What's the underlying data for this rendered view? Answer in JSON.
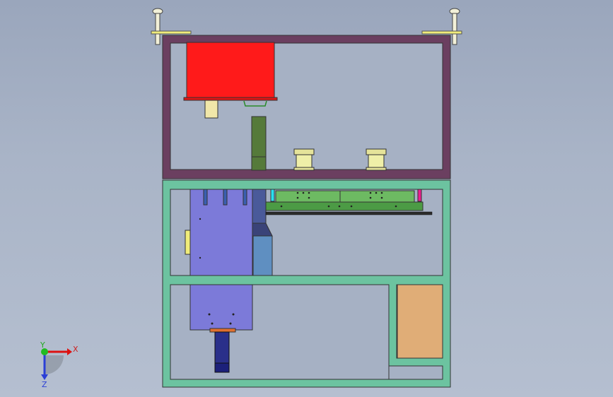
{
  "colors": {
    "background": "#a6b1c4",
    "upper_frame": "#6b3f60",
    "lower_frame": "#6cc3a0",
    "motor_body": "#ff1a1a",
    "motor_shaft": "#f1e7a9",
    "support_post": "#557a3a",
    "spool": "#e5e39a",
    "pcb": "#6dba62",
    "pcb_dark": "#4c9b45",
    "actuator_block": "#7c7ad9",
    "actuator_rod": "#2a2f8a",
    "slide_block": "#5f8fc1",
    "wood_panel": "#e0ad77",
    "lift_eye": "#f2f0d8",
    "yellow_bracket": "#f0ec7a",
    "cyan_marker": "#29e0f0",
    "magenta_marker": "#ee1f8e",
    "axis_x": "#dd1111",
    "axis_y": "#22bb22",
    "axis_z": "#2b3fd6"
  },
  "triad": {
    "x_label": "X",
    "y_label": "Y",
    "z_label": "Z"
  }
}
